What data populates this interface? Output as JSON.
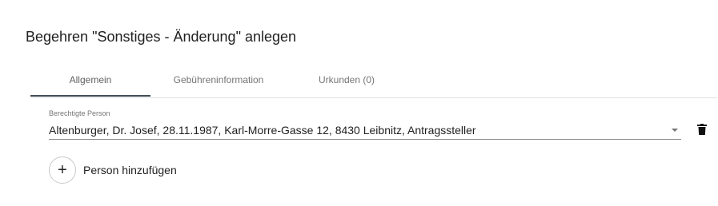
{
  "page": {
    "title": "Begehren \"Sonstiges - Änderung\" anlegen"
  },
  "tabs": [
    {
      "label": "Allgemein",
      "active": true
    },
    {
      "label": "Gebühreninformation",
      "active": false
    },
    {
      "label": "Urkunden (0)",
      "active": false
    }
  ],
  "person_field": {
    "label": "Berechtigte Person",
    "value": "Altenburger, Dr. Josef, 28.11.1987, Karl-Morre-Gasse 12, 8430 Leibnitz, Antragssteller",
    "dropdown_icon": "chevron-down-icon",
    "delete_icon": "trash-icon"
  },
  "add_person": {
    "icon": "plus-icon",
    "label": "Person hinzufügen"
  },
  "colors": {
    "active_tab_indicator": "#3f4d57",
    "divider": "#e0e0e0",
    "text_primary": "#212121",
    "text_secondary": "#757575"
  }
}
